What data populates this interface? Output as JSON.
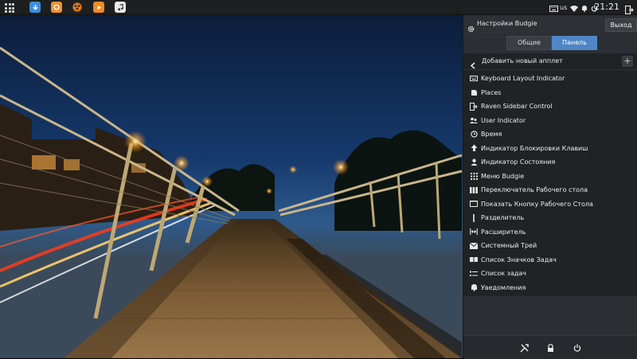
{
  "top_panel": {
    "launchers": [
      {
        "icon": "app-grid-icon"
      },
      {
        "icon": "download-manager-icon",
        "color": "#3d8de0"
      },
      {
        "icon": "firefox-icon",
        "color": "#f0922f"
      },
      {
        "icon": "media-player-icon",
        "color": "#e07b12"
      },
      {
        "icon": "vlc-play-icon",
        "color": "#f28a1d"
      },
      {
        "icon": "music-note-icon",
        "color": "#e9e9e9"
      }
    ],
    "keyboard_layout": "us",
    "clock": "21:21"
  },
  "raven": {
    "title": "Настройки Budgie",
    "exit_label": "Выход",
    "tabs": [
      {
        "label": "Общие",
        "active": false
      },
      {
        "label": "Панель",
        "active": true
      }
    ],
    "add_applet_title": "Добавить новый апплет",
    "add_button": "+",
    "applets": [
      {
        "label": "Keyboard Layout Indicator",
        "icon": "keyboard-icon"
      },
      {
        "label": "Places",
        "icon": "folder-icon"
      },
      {
        "label": "Raven Sidebar Control",
        "icon": "sidebar-control-icon"
      },
      {
        "label": "User Indicator",
        "icon": "users-icon"
      },
      {
        "label": "Время",
        "icon": "clock-icon"
      },
      {
        "label": "Индикатор Блокировки Клавиш",
        "icon": "lock-keys-icon"
      },
      {
        "label": "Индикатор Состояния",
        "icon": "user-status-icon"
      },
      {
        "label": "Меню Budgie",
        "icon": "menu-grid-icon"
      },
      {
        "label": "Переключатель Рабочего стола",
        "icon": "workspace-switcher-icon"
      },
      {
        "label": "Показать Кнопку Рабочего Стола",
        "icon": "show-desktop-icon"
      },
      {
        "label": "Разделитель",
        "icon": "separator-icon"
      },
      {
        "label": "Расширитель",
        "icon": "spacer-icon"
      },
      {
        "label": "Системный Трей",
        "icon": "tray-envelope-icon"
      },
      {
        "label": "Список Значков Задач",
        "icon": "icon-tasklist-icon"
      },
      {
        "label": "Список задач",
        "icon": "tasklist-icon"
      },
      {
        "label": "Уведомления",
        "icon": "bell-icon"
      }
    ],
    "footer": [
      {
        "icon": "settings-tools-icon"
      },
      {
        "icon": "lock-icon"
      },
      {
        "icon": "power-icon"
      }
    ],
    "colors": {
      "accent": "#4f86c6",
      "background": "#2b2e32",
      "list_background": "#202326"
    }
  }
}
